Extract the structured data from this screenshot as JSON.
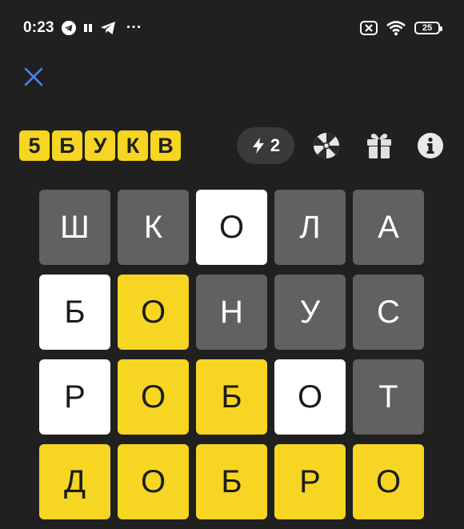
{
  "status_bar": {
    "time": "0:23",
    "more": "···",
    "battery": "25"
  },
  "title_letters": [
    "5",
    "Б",
    "У",
    "К",
    "В"
  ],
  "hint": {
    "count": "2"
  },
  "icons": {
    "close": "close-icon",
    "lightning": "lightning-icon",
    "wheel": "wheel-icon",
    "gift": "gift-icon",
    "info": "info-icon"
  },
  "colors": {
    "background": "#202020",
    "yellow": "#f6d523",
    "gray": "#616161",
    "white": "#ffffff",
    "close_blue": "#4a86e8"
  },
  "board": [
    [
      {
        "letter": "Ш",
        "state": "gray"
      },
      {
        "letter": "К",
        "state": "gray"
      },
      {
        "letter": "О",
        "state": "white"
      },
      {
        "letter": "Л",
        "state": "gray"
      },
      {
        "letter": "А",
        "state": "gray"
      }
    ],
    [
      {
        "letter": "Б",
        "state": "white"
      },
      {
        "letter": "О",
        "state": "yellow"
      },
      {
        "letter": "Н",
        "state": "gray"
      },
      {
        "letter": "У",
        "state": "gray"
      },
      {
        "letter": "С",
        "state": "gray"
      }
    ],
    [
      {
        "letter": "Р",
        "state": "white"
      },
      {
        "letter": "О",
        "state": "yellow"
      },
      {
        "letter": "Б",
        "state": "yellow"
      },
      {
        "letter": "О",
        "state": "white"
      },
      {
        "letter": "Т",
        "state": "gray"
      }
    ],
    [
      {
        "letter": "Д",
        "state": "yellow"
      },
      {
        "letter": "О",
        "state": "yellow"
      },
      {
        "letter": "Б",
        "state": "yellow"
      },
      {
        "letter": "Р",
        "state": "yellow"
      },
      {
        "letter": "О",
        "state": "yellow"
      }
    ]
  ]
}
